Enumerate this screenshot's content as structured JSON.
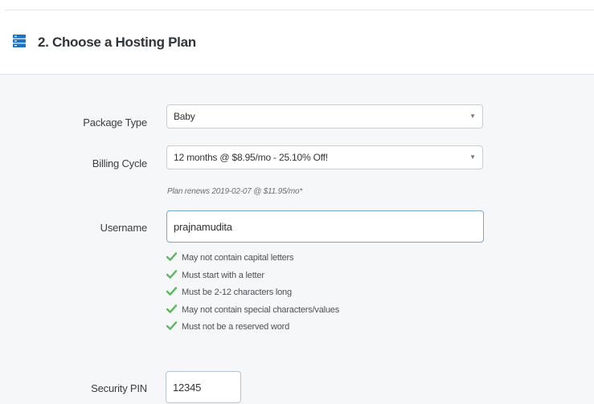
{
  "section": {
    "title": "2. Choose a Hosting Plan",
    "icon": "server-icon",
    "accent_color": "#1a73c8"
  },
  "form": {
    "package_type": {
      "label": "Package Type",
      "value": "Baby"
    },
    "billing_cycle": {
      "label": "Billing Cycle",
      "value": "12 months @ $8.95/mo - 25.10% Off!",
      "note": "Plan renews 2019-02-07 @ $11.95/mo*"
    },
    "username": {
      "label": "Username",
      "value": "prajnamudita",
      "rules": [
        "May not contain capital letters",
        "Must start with a letter",
        "Must be 2-12 characters long",
        "May not contain special characters/values",
        "Must not be a reserved word"
      ],
      "rule_icon": "check-icon",
      "rule_color": "#5cb85c"
    },
    "security_pin": {
      "label": "Security PIN",
      "value": "12345"
    }
  }
}
